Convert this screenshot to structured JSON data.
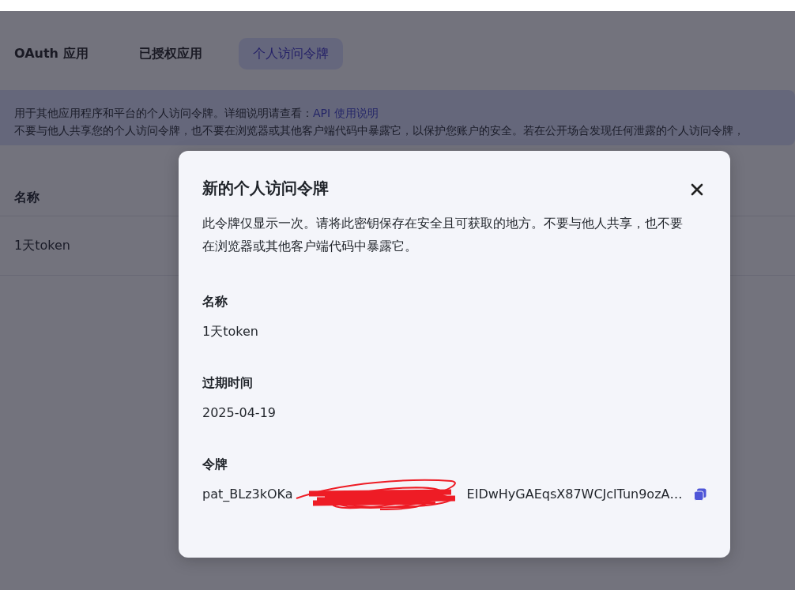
{
  "tabs": [
    {
      "label": "OAuth 应用",
      "selected": false
    },
    {
      "label": "已授权应用",
      "selected": false
    },
    {
      "label": "个人访问令牌",
      "selected": true
    }
  ],
  "notice": {
    "text": "用于其他应用程序和平台的个人访问令牌。详细说明请查看：",
    "link": "API 使用说明",
    "text_2": "不要与他人共享您的个人访问令牌，也不要在浏览器或其他客户端代码中暴露它，以保护您账户的安全。若在公开场合发现任何泄露的个人访问令牌，"
  },
  "table": {
    "columns": [
      "名称"
    ],
    "rows": [
      [
        "1天token"
      ]
    ]
  },
  "dialog": {
    "title": "新的个人访问令牌",
    "message": "此令牌仅显示一次。请将此密钥保存在安全且可获取的地方。不要与他人共享，也不要在浏览器或其他客户端代码中暴露它。",
    "fields": [
      {
        "kind": "text",
        "label": "名称",
        "value": "1天token"
      },
      {
        "kind": "text",
        "label": "过期时间",
        "value": "2025-04-19"
      },
      {
        "kind": "token",
        "label": "令牌",
        "value": "pat_BLz3kOKa",
        "value_end": "EIDwHyGAEqsX87WCJclTun9ozA…"
      }
    ]
  }
}
